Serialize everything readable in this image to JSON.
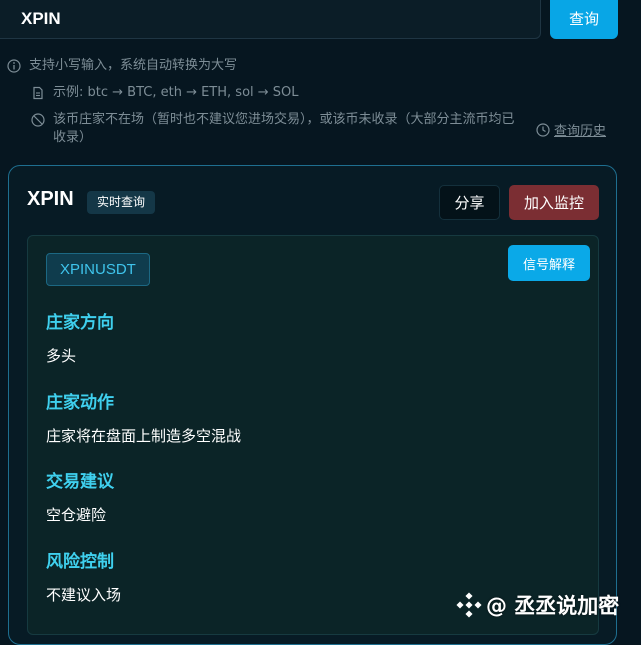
{
  "search": {
    "value": "XPIN",
    "button_label": "查询"
  },
  "hints": {
    "lowercase": "支持小写输入，系统自动转换为大写",
    "example": "示例: btc → BTC, eth → ETH, sol → SOL",
    "not_found": "该币庄家不在场（暂时也不建议您进场交易），或该币未收录（大部分主流币均已收录）",
    "history_label": "查询历史"
  },
  "result": {
    "symbol": "XPIN",
    "realtime_badge": "实时查询",
    "share_label": "分享",
    "monitor_label": "加入监控",
    "pair": "XPINUSDT",
    "signal_label": "信号解释",
    "sections": [
      {
        "title": "庄家方向",
        "value": "多头"
      },
      {
        "title": "庄家动作",
        "value": "庄家将在盘面上制造多空混战"
      },
      {
        "title": "交易建议",
        "value": "空仓避险"
      },
      {
        "title": "风险控制",
        "value": "不建议入场"
      }
    ]
  },
  "watermark": {
    "text": "@ 丞丞说加密"
  },
  "colors": {
    "accent": "#08a6e6",
    "section_title": "#3fd0ee",
    "monitor_button": "#7b2e33",
    "background": "#061620"
  }
}
